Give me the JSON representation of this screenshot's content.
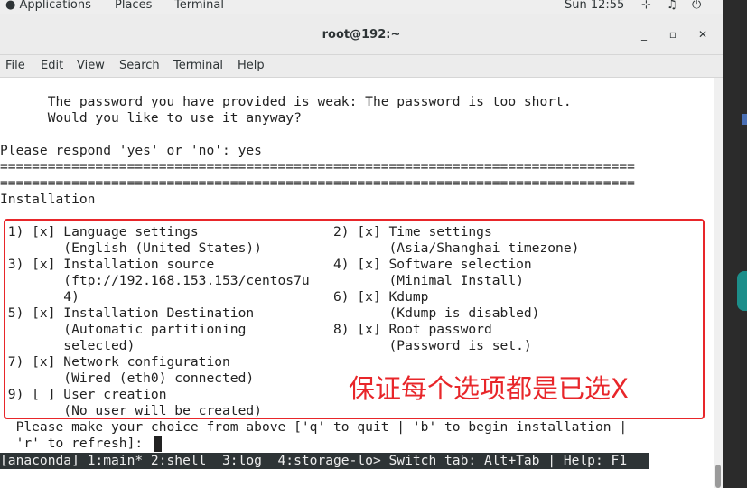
{
  "topbar": {
    "applications": "Applications",
    "places": "Places",
    "terminal": "Terminal",
    "clock": "Sun 12:55"
  },
  "window": {
    "title": "root@192:~",
    "minimize": "_",
    "maximize": "▫",
    "close": "✕"
  },
  "menu": [
    "File",
    "Edit",
    "View",
    "Search",
    "Terminal",
    "Help"
  ],
  "terminal": {
    "lines": [
      "      The password you have provided is weak: The password is too short.",
      "      Would you like to use it anyway?",
      "",
      "Please respond 'yes' or 'no': yes",
      "================================================================================",
      "================================================================================",
      "Installation",
      "",
      " 1) [x] Language settings                 2) [x] Time settings",
      "        (English (United States))                (Asia/Shanghai timezone)",
      " 3) [x] Installation source               4) [x] Software selection",
      "        (ftp://192.168.153.153/centos7u          (Minimal Install)",
      "        4)                                6) [x] Kdump",
      " 5) [x] Installation Destination                 (Kdump is disabled)",
      "        (Automatic partitioning           8) [x] Root password",
      "        selected)                                (Password is set.)",
      " 7) [x] Network configuration",
      "        (Wired (eth0) connected)",
      " 9) [ ] User creation",
      "        (No user will be created)",
      "  Please make your choice from above ['q' to quit | 'b' to begin installation |",
      "  'r' to refresh]: "
    ],
    "status": "[anaconda] 1:main* 2:shell  3:log  4:storage-lo> Switch tab: Alt+Tab | Help: F1"
  },
  "annotation": "保证每个选项都是已选X",
  "colors": {
    "annotation": "#e8262a",
    "status_bg": "#2e3436"
  }
}
